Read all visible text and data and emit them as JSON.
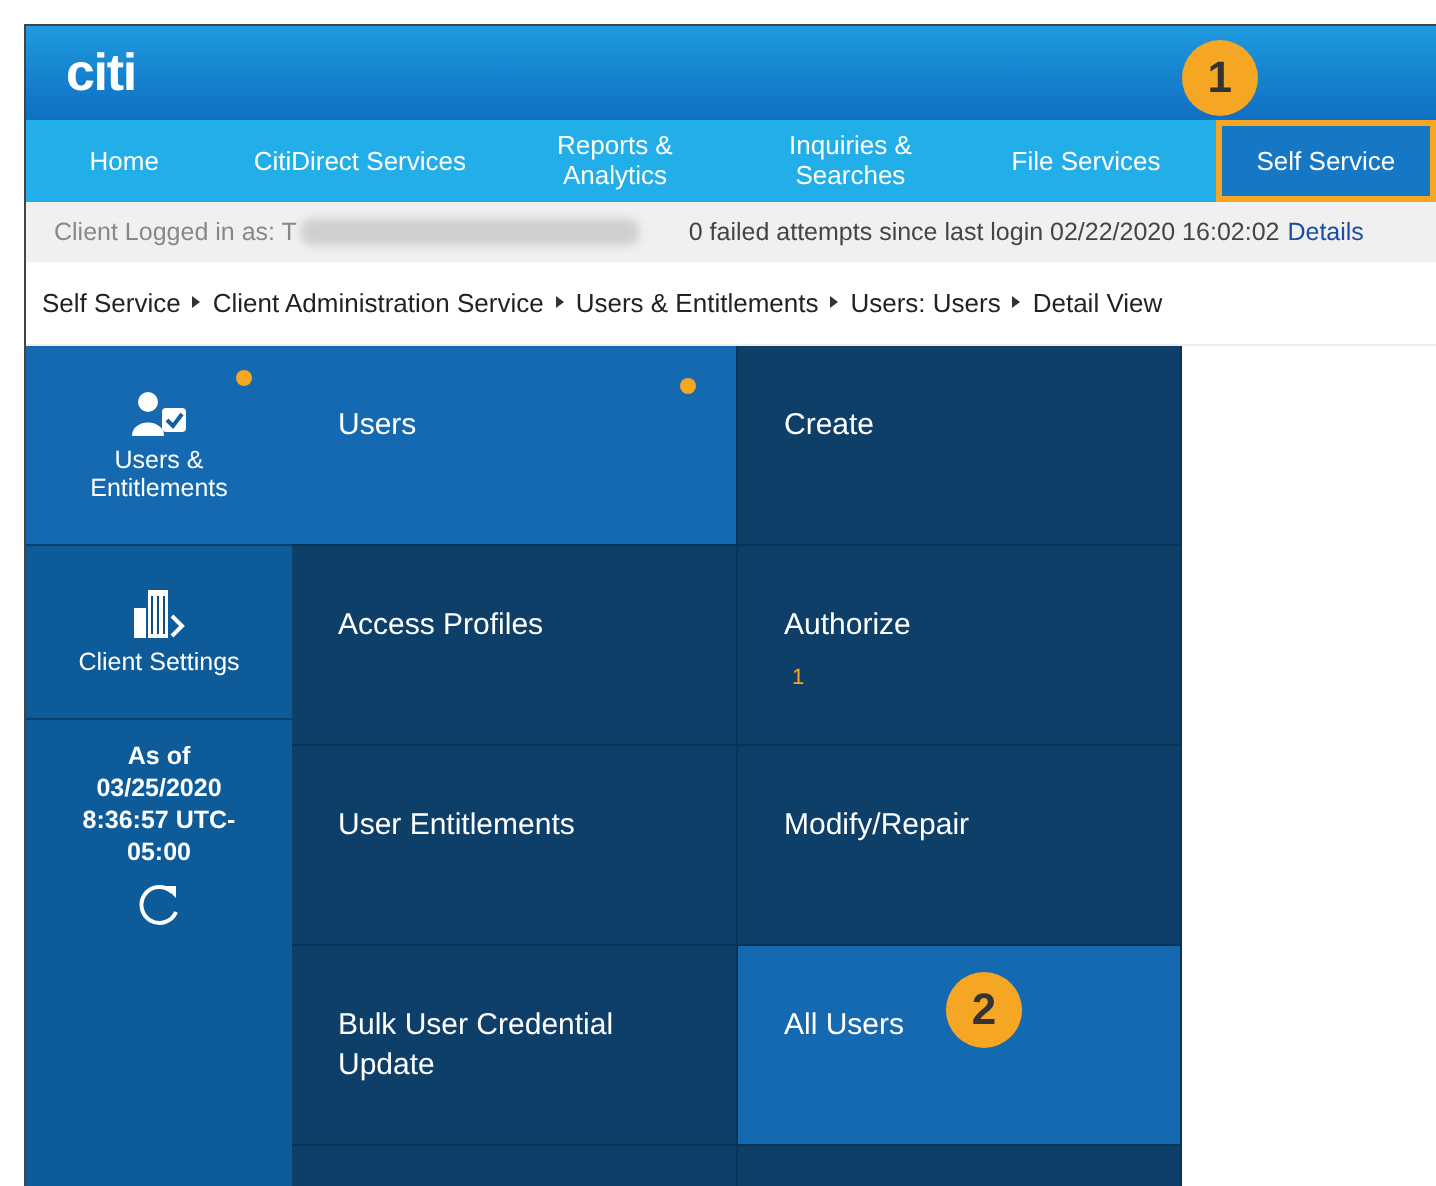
{
  "header": {
    "logo": "citi"
  },
  "nav": [
    {
      "label": "Home",
      "selected": false
    },
    {
      "label": "CitiDirect Services",
      "selected": false
    },
    {
      "label": "Reports & Analytics",
      "selected": false
    },
    {
      "label": "Inquiries & Searches",
      "selected": false
    },
    {
      "label": "File Services",
      "selected": false
    },
    {
      "label": "Self Service",
      "selected": true,
      "callout": "1"
    }
  ],
  "info_bar": {
    "logged_in_label": "Client Logged in as: T",
    "failed_attempts": "0 failed attempts since last login 02/22/2020 16:02:02",
    "details_link": "Details"
  },
  "breadcrumb": [
    "Self Service",
    "Client Administration Service",
    "Users & Entitlements",
    "Users: Users",
    "Detail View"
  ],
  "sidebar": {
    "items": [
      {
        "kind": "users",
        "label": "Users & Entitlements",
        "selected": true,
        "dot": true
      },
      {
        "kind": "building",
        "label": "Client Settings",
        "selected": false,
        "dot": false
      }
    ],
    "timestamp": [
      "As of",
      "03/25/2020",
      "8:36:57 UTC-",
      "05:00"
    ]
  },
  "menu_columns": [
    [
      {
        "label": "Users",
        "selected": true,
        "dot": true
      },
      {
        "label": "Access Profiles",
        "selected": false,
        "dot": false
      },
      {
        "label": "User Entitlements",
        "selected": false,
        "dot": false
      },
      {
        "label": "Bulk User Credential Update",
        "selected": false,
        "dot": false
      }
    ],
    [
      {
        "label": "Create",
        "selected": false,
        "dot": false
      },
      {
        "label": "Authorize",
        "selected": false,
        "dot": false,
        "badge": "1"
      },
      {
        "label": "Modify/Repair",
        "selected": false,
        "dot": false
      },
      {
        "label": "All Users",
        "selected": true,
        "dot": false,
        "callout": "2"
      }
    ]
  ]
}
